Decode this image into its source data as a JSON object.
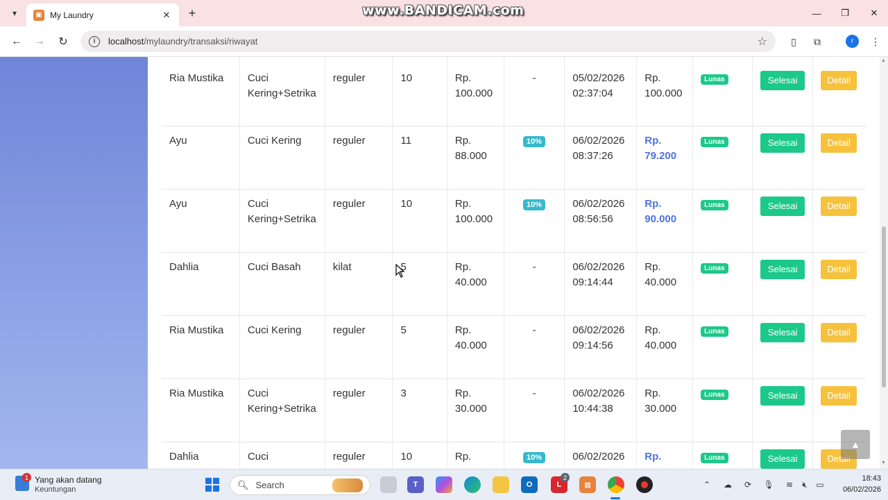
{
  "browser": {
    "tab_title": "My Laundry",
    "tab_favicon": "laundry-icon",
    "tab_close": "✕",
    "new_tab": "+",
    "watermark": "www.BANDICAM.com",
    "url_host": "localhost",
    "url_path": "/mylaundry/transaksi/riwayat",
    "profile_initial": "r"
  },
  "table": {
    "rows": [
      {
        "customer": "Ria Mustika",
        "service": "Cuci Kering+Setrika",
        "type": "reguler",
        "qty": "10",
        "price": "Rp. 100.000",
        "discount": "-",
        "date": "05/02/2026",
        "time": "02:37:04",
        "total": "Rp. 100.000",
        "discounted": false,
        "status": "Lunas",
        "btn_done": "Selesai",
        "btn_detail": "Detail"
      },
      {
        "customer": "Ayu",
        "service": "Cuci Kering",
        "type": "reguler",
        "qty": "11",
        "price": "Rp. 88.000",
        "discount": "10%",
        "date": "06/02/2026",
        "time": "08:37:26",
        "total": "Rp. 79.200",
        "discounted": true,
        "status": "Lunas",
        "btn_done": "Selesai",
        "btn_detail": "Detail"
      },
      {
        "customer": "Ayu",
        "service": "Cuci Kering+Setrika",
        "type": "reguler",
        "qty": "10",
        "price": "Rp. 100.000",
        "discount": "10%",
        "date": "06/02/2026",
        "time": "08:56:56",
        "total": "Rp. 90.000",
        "discounted": true,
        "status": "Lunas",
        "btn_done": "Selesai",
        "btn_detail": "Detail"
      },
      {
        "customer": "Dahlia",
        "service": "Cuci Basah",
        "type": "kilat",
        "qty": "5",
        "price": "Rp. 40.000",
        "discount": "-",
        "date": "06/02/2026",
        "time": "09:14:44",
        "total": "Rp. 40.000",
        "discounted": false,
        "status": "Lunas",
        "btn_done": "Selesai",
        "btn_detail": "Detail"
      },
      {
        "customer": "Ria Mustika",
        "service": "Cuci Kering",
        "type": "reguler",
        "qty": "5",
        "price": "Rp. 40.000",
        "discount": "-",
        "date": "06/02/2026",
        "time": "09:14:56",
        "total": "Rp. 40.000",
        "discounted": false,
        "status": "Lunas",
        "btn_done": "Selesai",
        "btn_detail": "Detail"
      },
      {
        "customer": "Ria Mustika",
        "service": "Cuci Kering+Setrika",
        "type": "reguler",
        "qty": "3",
        "price": "Rp. 30.000",
        "discount": "-",
        "date": "06/02/2026",
        "time": "10:44:38",
        "total": "Rp. 30.000",
        "discounted": false,
        "status": "Lunas",
        "btn_done": "Selesai",
        "btn_detail": "Detail"
      },
      {
        "customer": "Dahlia",
        "service": "Cuci",
        "type": "reguler",
        "qty": "10",
        "price": "Rp.",
        "discount": "10%",
        "date": "06/02/2026",
        "time": "",
        "total": "Rp.",
        "discounted": true,
        "status": "Lunas",
        "btn_done": "Selesai",
        "btn_detail": "Detail"
      }
    ]
  },
  "taskbar": {
    "news_title": "Yang akan datang",
    "news_sub": "Keuntungan",
    "notif_count": "1",
    "search_label": "Search",
    "app_badge": "2",
    "time": "18:43",
    "date": "06/02/2026"
  },
  "colors": {
    "sidebar": "#6f85d8",
    "badge_info": "#36b9cc",
    "success": "#1cc88a",
    "warning": "#f6c23e",
    "primary": "#4e73df"
  }
}
